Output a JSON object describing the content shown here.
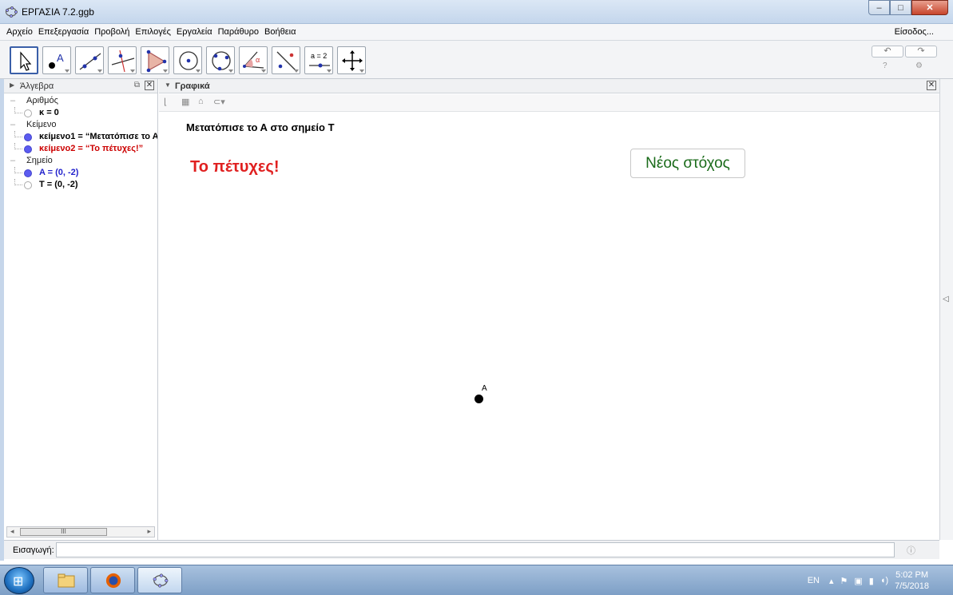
{
  "window": {
    "title": "ΕΡΓΑΣΙΑ  7.2.ggb",
    "min_label": "–",
    "max_label": "□",
    "close_label": "✕"
  },
  "menu": {
    "items": [
      "Αρχείο",
      "Επεξεργασία",
      "Προβολή",
      "Επιλογές",
      "Εργαλεία",
      "Παράθυρο",
      "Βοήθεια"
    ],
    "login": "Είσοδος..."
  },
  "toolbar": {
    "tools": [
      "move-tool",
      "point-tool",
      "line-tool",
      "perpendicular-tool",
      "polygon-tool",
      "circle-tool",
      "circle-three-points-tool",
      "angle-tool",
      "reflect-tool",
      "slider-tool",
      "move-view-tool"
    ],
    "slider_label": "a = 2",
    "undo": "↶",
    "redo": "↷",
    "help": "?",
    "settings": "⚙"
  },
  "algebra": {
    "title": "Άλγεβρα",
    "groups": [
      {
        "label": "Αριθμός",
        "items": [
          {
            "text": "κ = 0",
            "visible": false,
            "color": "#000000"
          }
        ]
      },
      {
        "label": "Κείμενο",
        "items": [
          {
            "text": "κείμενο1 = “Μετατόπισε το Α",
            "visible": true,
            "color": "#000000"
          },
          {
            "text": "κείμενο2 = “Το πέτυχες!”",
            "visible": true,
            "color": "#cc0000"
          }
        ]
      },
      {
        "label": "Σημείο",
        "items": [
          {
            "text": "A = (0, -2)",
            "visible": true,
            "color": "#2222cc"
          },
          {
            "text": "T = (0, -2)",
            "visible": false,
            "color": "#000000"
          }
        ]
      }
    ]
  },
  "graphics": {
    "title": "Γραφικά",
    "instruction": "Μετατόπισε το Α στο σημείο Τ",
    "success_text": "Το πέτυχες!",
    "button_label": "Νέος στόχος",
    "point_label": "A"
  },
  "input": {
    "label": "Εισαγωγή:",
    "value": ""
  },
  "taskbar": {
    "lang": "EN",
    "time": "5:02 PM",
    "date": "7/5/2018"
  },
  "colors": {
    "success": "#e02020",
    "button_text": "#1a6b1a",
    "point": "#000000"
  }
}
